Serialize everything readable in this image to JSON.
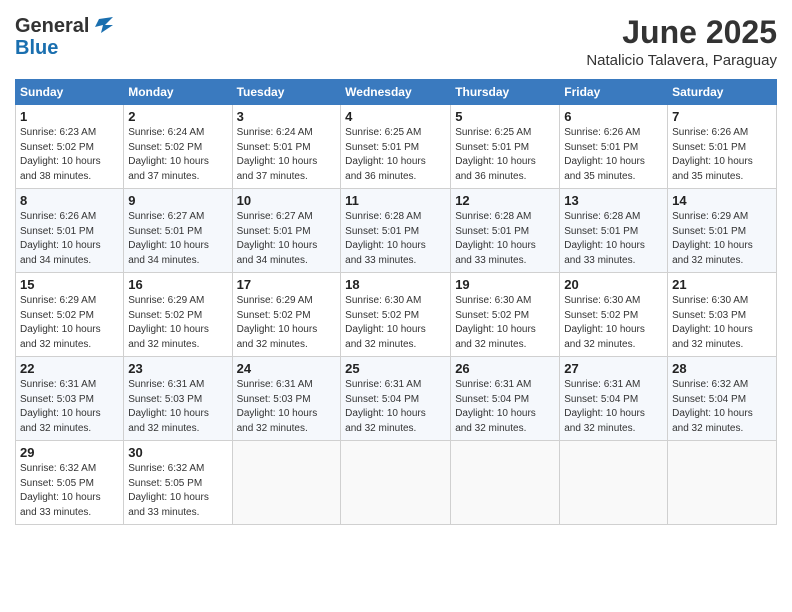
{
  "logo": {
    "general": "General",
    "blue": "Blue"
  },
  "header": {
    "month_year": "June 2025",
    "location": "Natalicio Talavera, Paraguay"
  },
  "weekdays": [
    "Sunday",
    "Monday",
    "Tuesday",
    "Wednesday",
    "Thursday",
    "Friday",
    "Saturday"
  ],
  "weeks": [
    [
      {
        "day": "1",
        "info": "Sunrise: 6:23 AM\nSunset: 5:02 PM\nDaylight: 10 hours\nand 38 minutes."
      },
      {
        "day": "2",
        "info": "Sunrise: 6:24 AM\nSunset: 5:02 PM\nDaylight: 10 hours\nand 37 minutes."
      },
      {
        "day": "3",
        "info": "Sunrise: 6:24 AM\nSunset: 5:01 PM\nDaylight: 10 hours\nand 37 minutes."
      },
      {
        "day": "4",
        "info": "Sunrise: 6:25 AM\nSunset: 5:01 PM\nDaylight: 10 hours\nand 36 minutes."
      },
      {
        "day": "5",
        "info": "Sunrise: 6:25 AM\nSunset: 5:01 PM\nDaylight: 10 hours\nand 36 minutes."
      },
      {
        "day": "6",
        "info": "Sunrise: 6:26 AM\nSunset: 5:01 PM\nDaylight: 10 hours\nand 35 minutes."
      },
      {
        "day": "7",
        "info": "Sunrise: 6:26 AM\nSunset: 5:01 PM\nDaylight: 10 hours\nand 35 minutes."
      }
    ],
    [
      {
        "day": "8",
        "info": "Sunrise: 6:26 AM\nSunset: 5:01 PM\nDaylight: 10 hours\nand 34 minutes."
      },
      {
        "day": "9",
        "info": "Sunrise: 6:27 AM\nSunset: 5:01 PM\nDaylight: 10 hours\nand 34 minutes."
      },
      {
        "day": "10",
        "info": "Sunrise: 6:27 AM\nSunset: 5:01 PM\nDaylight: 10 hours\nand 34 minutes."
      },
      {
        "day": "11",
        "info": "Sunrise: 6:28 AM\nSunset: 5:01 PM\nDaylight: 10 hours\nand 33 minutes."
      },
      {
        "day": "12",
        "info": "Sunrise: 6:28 AM\nSunset: 5:01 PM\nDaylight: 10 hours\nand 33 minutes."
      },
      {
        "day": "13",
        "info": "Sunrise: 6:28 AM\nSunset: 5:01 PM\nDaylight: 10 hours\nand 33 minutes."
      },
      {
        "day": "14",
        "info": "Sunrise: 6:29 AM\nSunset: 5:01 PM\nDaylight: 10 hours\nand 32 minutes."
      }
    ],
    [
      {
        "day": "15",
        "info": "Sunrise: 6:29 AM\nSunset: 5:02 PM\nDaylight: 10 hours\nand 32 minutes."
      },
      {
        "day": "16",
        "info": "Sunrise: 6:29 AM\nSunset: 5:02 PM\nDaylight: 10 hours\nand 32 minutes."
      },
      {
        "day": "17",
        "info": "Sunrise: 6:29 AM\nSunset: 5:02 PM\nDaylight: 10 hours\nand 32 minutes."
      },
      {
        "day": "18",
        "info": "Sunrise: 6:30 AM\nSunset: 5:02 PM\nDaylight: 10 hours\nand 32 minutes."
      },
      {
        "day": "19",
        "info": "Sunrise: 6:30 AM\nSunset: 5:02 PM\nDaylight: 10 hours\nand 32 minutes."
      },
      {
        "day": "20",
        "info": "Sunrise: 6:30 AM\nSunset: 5:02 PM\nDaylight: 10 hours\nand 32 minutes."
      },
      {
        "day": "21",
        "info": "Sunrise: 6:30 AM\nSunset: 5:03 PM\nDaylight: 10 hours\nand 32 minutes."
      }
    ],
    [
      {
        "day": "22",
        "info": "Sunrise: 6:31 AM\nSunset: 5:03 PM\nDaylight: 10 hours\nand 32 minutes."
      },
      {
        "day": "23",
        "info": "Sunrise: 6:31 AM\nSunset: 5:03 PM\nDaylight: 10 hours\nand 32 minutes."
      },
      {
        "day": "24",
        "info": "Sunrise: 6:31 AM\nSunset: 5:03 PM\nDaylight: 10 hours\nand 32 minutes."
      },
      {
        "day": "25",
        "info": "Sunrise: 6:31 AM\nSunset: 5:04 PM\nDaylight: 10 hours\nand 32 minutes."
      },
      {
        "day": "26",
        "info": "Sunrise: 6:31 AM\nSunset: 5:04 PM\nDaylight: 10 hours\nand 32 minutes."
      },
      {
        "day": "27",
        "info": "Sunrise: 6:31 AM\nSunset: 5:04 PM\nDaylight: 10 hours\nand 32 minutes."
      },
      {
        "day": "28",
        "info": "Sunrise: 6:32 AM\nSunset: 5:04 PM\nDaylight: 10 hours\nand 32 minutes."
      }
    ],
    [
      {
        "day": "29",
        "info": "Sunrise: 6:32 AM\nSunset: 5:05 PM\nDaylight: 10 hours\nand 33 minutes."
      },
      {
        "day": "30",
        "info": "Sunrise: 6:32 AM\nSunset: 5:05 PM\nDaylight: 10 hours\nand 33 minutes."
      },
      {
        "day": "",
        "info": ""
      },
      {
        "day": "",
        "info": ""
      },
      {
        "day": "",
        "info": ""
      },
      {
        "day": "",
        "info": ""
      },
      {
        "day": "",
        "info": ""
      }
    ]
  ]
}
